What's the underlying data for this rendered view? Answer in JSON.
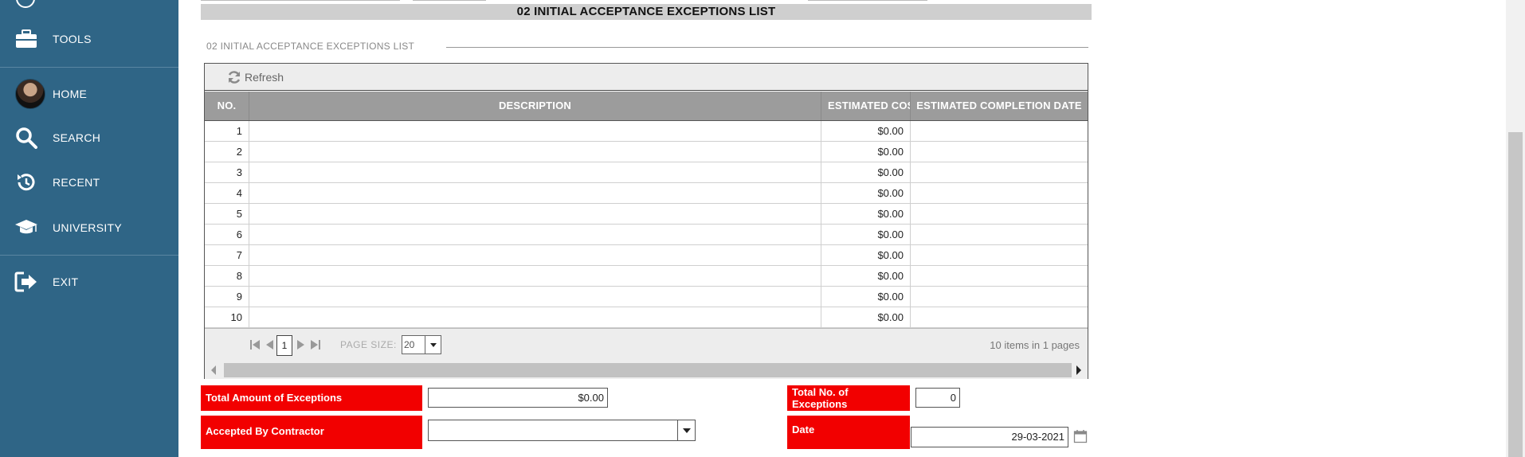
{
  "sidebar": {
    "items": [
      {
        "label": "TOOLS",
        "icon": "toolbox-icon"
      },
      {
        "label": "HOME",
        "icon": "avatar"
      },
      {
        "label": "SEARCH",
        "icon": "search-icon"
      },
      {
        "label": "RECENT",
        "icon": "history-icon"
      },
      {
        "label": "UNIVERSITY",
        "icon": "graduation-cap-icon"
      },
      {
        "label": "EXIT",
        "icon": "exit-icon"
      }
    ]
  },
  "section": {
    "header_title": "02 INITIAL ACCEPTANCE EXCEPTIONS LIST",
    "legend": "02 INITIAL ACCEPTANCE EXCEPTIONS LIST"
  },
  "grid": {
    "refresh_label": "Refresh",
    "columns": [
      "NO.",
      "DESCRIPTION",
      "ESTIMATED COST",
      "ESTIMATED COMPLETION DATE"
    ],
    "rows": [
      {
        "no": "1",
        "description": "",
        "cost": "$0.00",
        "date": ""
      },
      {
        "no": "2",
        "description": "",
        "cost": "$0.00",
        "date": ""
      },
      {
        "no": "3",
        "description": "",
        "cost": "$0.00",
        "date": ""
      },
      {
        "no": "4",
        "description": "",
        "cost": "$0.00",
        "date": ""
      },
      {
        "no": "5",
        "description": "",
        "cost": "$0.00",
        "date": ""
      },
      {
        "no": "6",
        "description": "",
        "cost": "$0.00",
        "date": ""
      },
      {
        "no": "7",
        "description": "",
        "cost": "$0.00",
        "date": ""
      },
      {
        "no": "8",
        "description": "",
        "cost": "$0.00",
        "date": ""
      },
      {
        "no": "9",
        "description": "",
        "cost": "$0.00",
        "date": ""
      },
      {
        "no": "10",
        "description": "",
        "cost": "$0.00",
        "date": ""
      }
    ],
    "pager": {
      "current_page": "1",
      "page_size_label": "PAGE SIZE:",
      "page_size": "20",
      "info": "10 items in 1 pages"
    }
  },
  "form": {
    "total_amount_label": "Total Amount of Exceptions",
    "total_amount_value": "$0.00",
    "total_no_label": "Total No. of Exceptions",
    "total_no_value": "0",
    "accepted_by_label": "Accepted By Contractor",
    "accepted_by_value": "",
    "date_label": "Date",
    "date_value": "29-03-2021"
  },
  "colors": {
    "sidebar": "#2f6586",
    "label_red": "#f20000",
    "header_grey": "#cfcfcf",
    "column_header": "#9c9c9c"
  }
}
